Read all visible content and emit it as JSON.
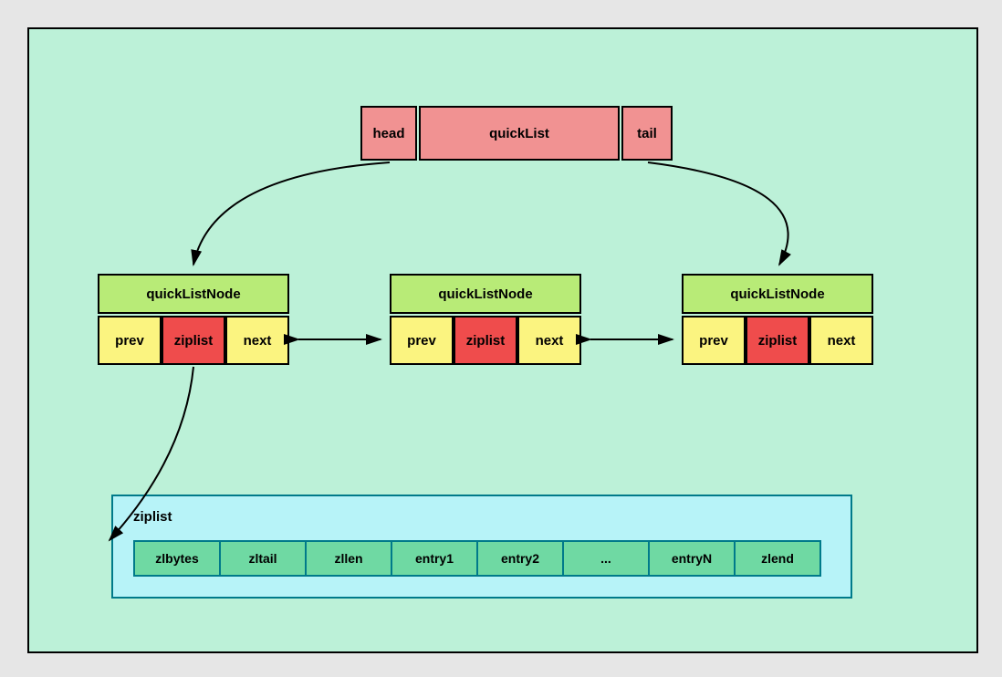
{
  "quicklist": {
    "head": "head",
    "main": "quickList",
    "tail": "tail"
  },
  "nodes": [
    {
      "title": "quickListNode",
      "prev": "prev",
      "ziplist": "ziplist",
      "next": "next"
    },
    {
      "title": "quickListNode",
      "prev": "prev",
      "ziplist": "ziplist",
      "next": "next"
    },
    {
      "title": "quickListNode",
      "prev": "prev",
      "ziplist": "ziplist",
      "next": "next"
    }
  ],
  "ziplist": {
    "title": "ziplist",
    "cells": [
      "zlbytes",
      "zltail",
      "zllen",
      "entry1",
      "entry2",
      "...",
      "entryN",
      "zlend"
    ]
  }
}
